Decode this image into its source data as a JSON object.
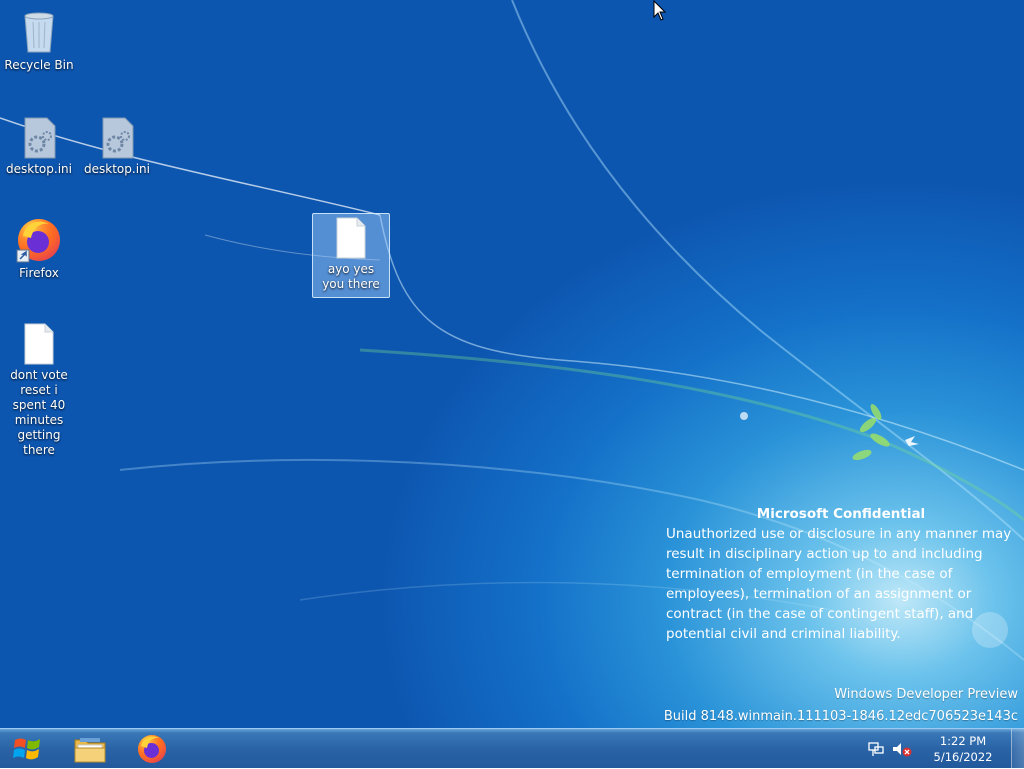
{
  "desktop": {
    "icons": [
      {
        "id": "recycle-bin",
        "label": "Recycle Bin",
        "icon": "recycle-bin-icon"
      },
      {
        "id": "desktop-ini-1",
        "label": "desktop.ini",
        "icon": "settings-file-icon"
      },
      {
        "id": "desktop-ini-2",
        "label": "desktop.ini",
        "icon": "settings-file-icon"
      },
      {
        "id": "firefox",
        "label": "Firefox",
        "icon": "firefox-icon"
      },
      {
        "id": "ayo-file",
        "label": "ayo yes you there",
        "icon": "text-file-icon",
        "selected": true
      },
      {
        "id": "dont-vote-file",
        "label": "dont vote reset i spent 40 minutes getting there",
        "icon": "text-file-icon"
      }
    ]
  },
  "watermark": {
    "title": "Microsoft Confidential",
    "body": "Unauthorized use or disclosure in any manner may result in disciplinary action up to and including termination of employment (in the case of employees), termination of an assignment or contract (in the case of contingent staff), and potential civil and criminal liability.",
    "product": "Windows Developer Preview",
    "build": "Build 8148.winmain.111103-1846.12edc706523e143c"
  },
  "taskbar": {
    "start_icon": "windows-logo-icon",
    "pinned": [
      {
        "name": "File Explorer",
        "icon": "folder-icon"
      },
      {
        "name": "Firefox",
        "icon": "firefox-icon"
      }
    ],
    "tray_icons": [
      "network-icon",
      "volume-muted-icon"
    ],
    "clock": {
      "time": "1:22 PM",
      "date": "5/16/2022"
    }
  },
  "colors": {
    "taskbar": "#2a64a6",
    "selection": "#aad2ff",
    "desktop_accent": "#1470c8"
  }
}
